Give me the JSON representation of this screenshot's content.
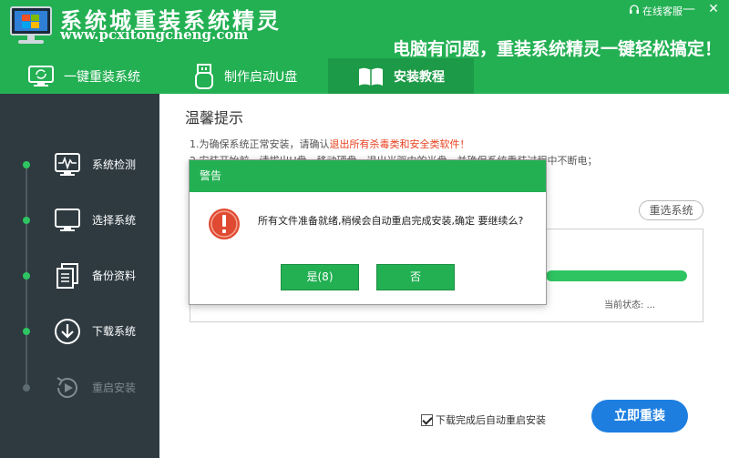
{
  "header": {
    "brand_title": "系统城重装系统精灵",
    "brand_url": "www.pcxitongcheng.com",
    "slogan": "电脑有问题，重装系统精灵一键轻松搞定！",
    "support_label": "在线客服",
    "minimize_glyph": "—",
    "close_glyph": "✕"
  },
  "tabs": [
    {
      "label": "一键重装系统",
      "icon": "monitor-refresh-icon"
    },
    {
      "label": "制作启动U盘",
      "icon": "usb-drive-icon"
    },
    {
      "label": "安装教程",
      "icon": "book-icon"
    }
  ],
  "sidebar": {
    "steps": [
      {
        "label": "系统检测",
        "icon": "pulse-monitor-icon",
        "done": true
      },
      {
        "label": "选择系统",
        "icon": "monitor-icon",
        "done": true
      },
      {
        "label": "备份资料",
        "icon": "documents-icon",
        "done": true
      },
      {
        "label": "下载系统",
        "icon": "download-icon",
        "done": true
      },
      {
        "label": "重启安装",
        "icon": "restart-icon",
        "done": false
      }
    ]
  },
  "main": {
    "title": "温馨提示",
    "tip1_prefix": "1.为确保系统正常安装，请确认",
    "tip1_warn": "退出所有杀毒类和安全类软件！",
    "tip2": "2.安装开始前，请拔出U盘、移动硬盘，退出光驱中的光盘，并确保系统重装过程中不断电；",
    "reselect_label": "重选系统",
    "progress_fraction": 1.0,
    "status_text": "当前状态: ...",
    "auto_restart_label": "下载完成后自动重启安装",
    "auto_restart_checked": true,
    "install_button": "立即重装"
  },
  "dialog": {
    "title": "警告",
    "message": "所有文件准备就绪,稍候会自动重启完成安装,确定 要继续么?",
    "yes_label": "是(8)",
    "no_label": "否"
  },
  "colors": {
    "brand_green": "#23b053",
    "sidebar_bg": "#2e3a40",
    "accent_blue": "#1d7ee0",
    "warning_red": "#e8411e"
  }
}
